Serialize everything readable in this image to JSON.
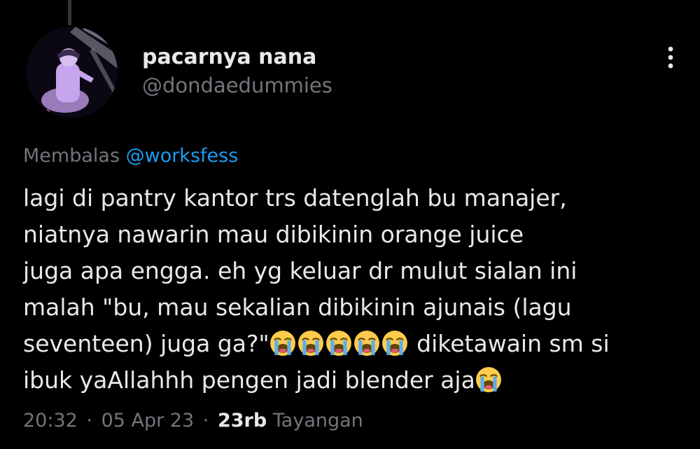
{
  "author": {
    "display_name": "pacarnya nana",
    "handle": "@dondaedummies"
  },
  "reply": {
    "prefix": "Membalas",
    "mention": "@worksfess"
  },
  "tweet": {
    "line1": "lagi di pantry kantor trs datenglah bu manajer,",
    "line2": "niatnya nawarin mau dibikinin orange juice",
    "line3": "juga apa engga. eh yg keluar dr mulut sialan ini",
    "line4": "malah \"bu, mau sekalian dibikinin ajunais (lagu",
    "line5_text": "seventeen) juga ga?\"",
    "line5_after": " diketawain sm si",
    "line6_text": "ibuk yaAllahhh pengen jadi blender aja",
    "emoji_icon": "loudly-crying-face-emoji"
  },
  "meta": {
    "time": "20:32",
    "date": "05 Apr 23",
    "separator": "·",
    "views_count": "23rb",
    "views_label": "Tayangan"
  },
  "colors": {
    "background": "#000000",
    "text": "#e7e9ea",
    "secondary": "#71767b",
    "accent": "#1d9bf0"
  }
}
